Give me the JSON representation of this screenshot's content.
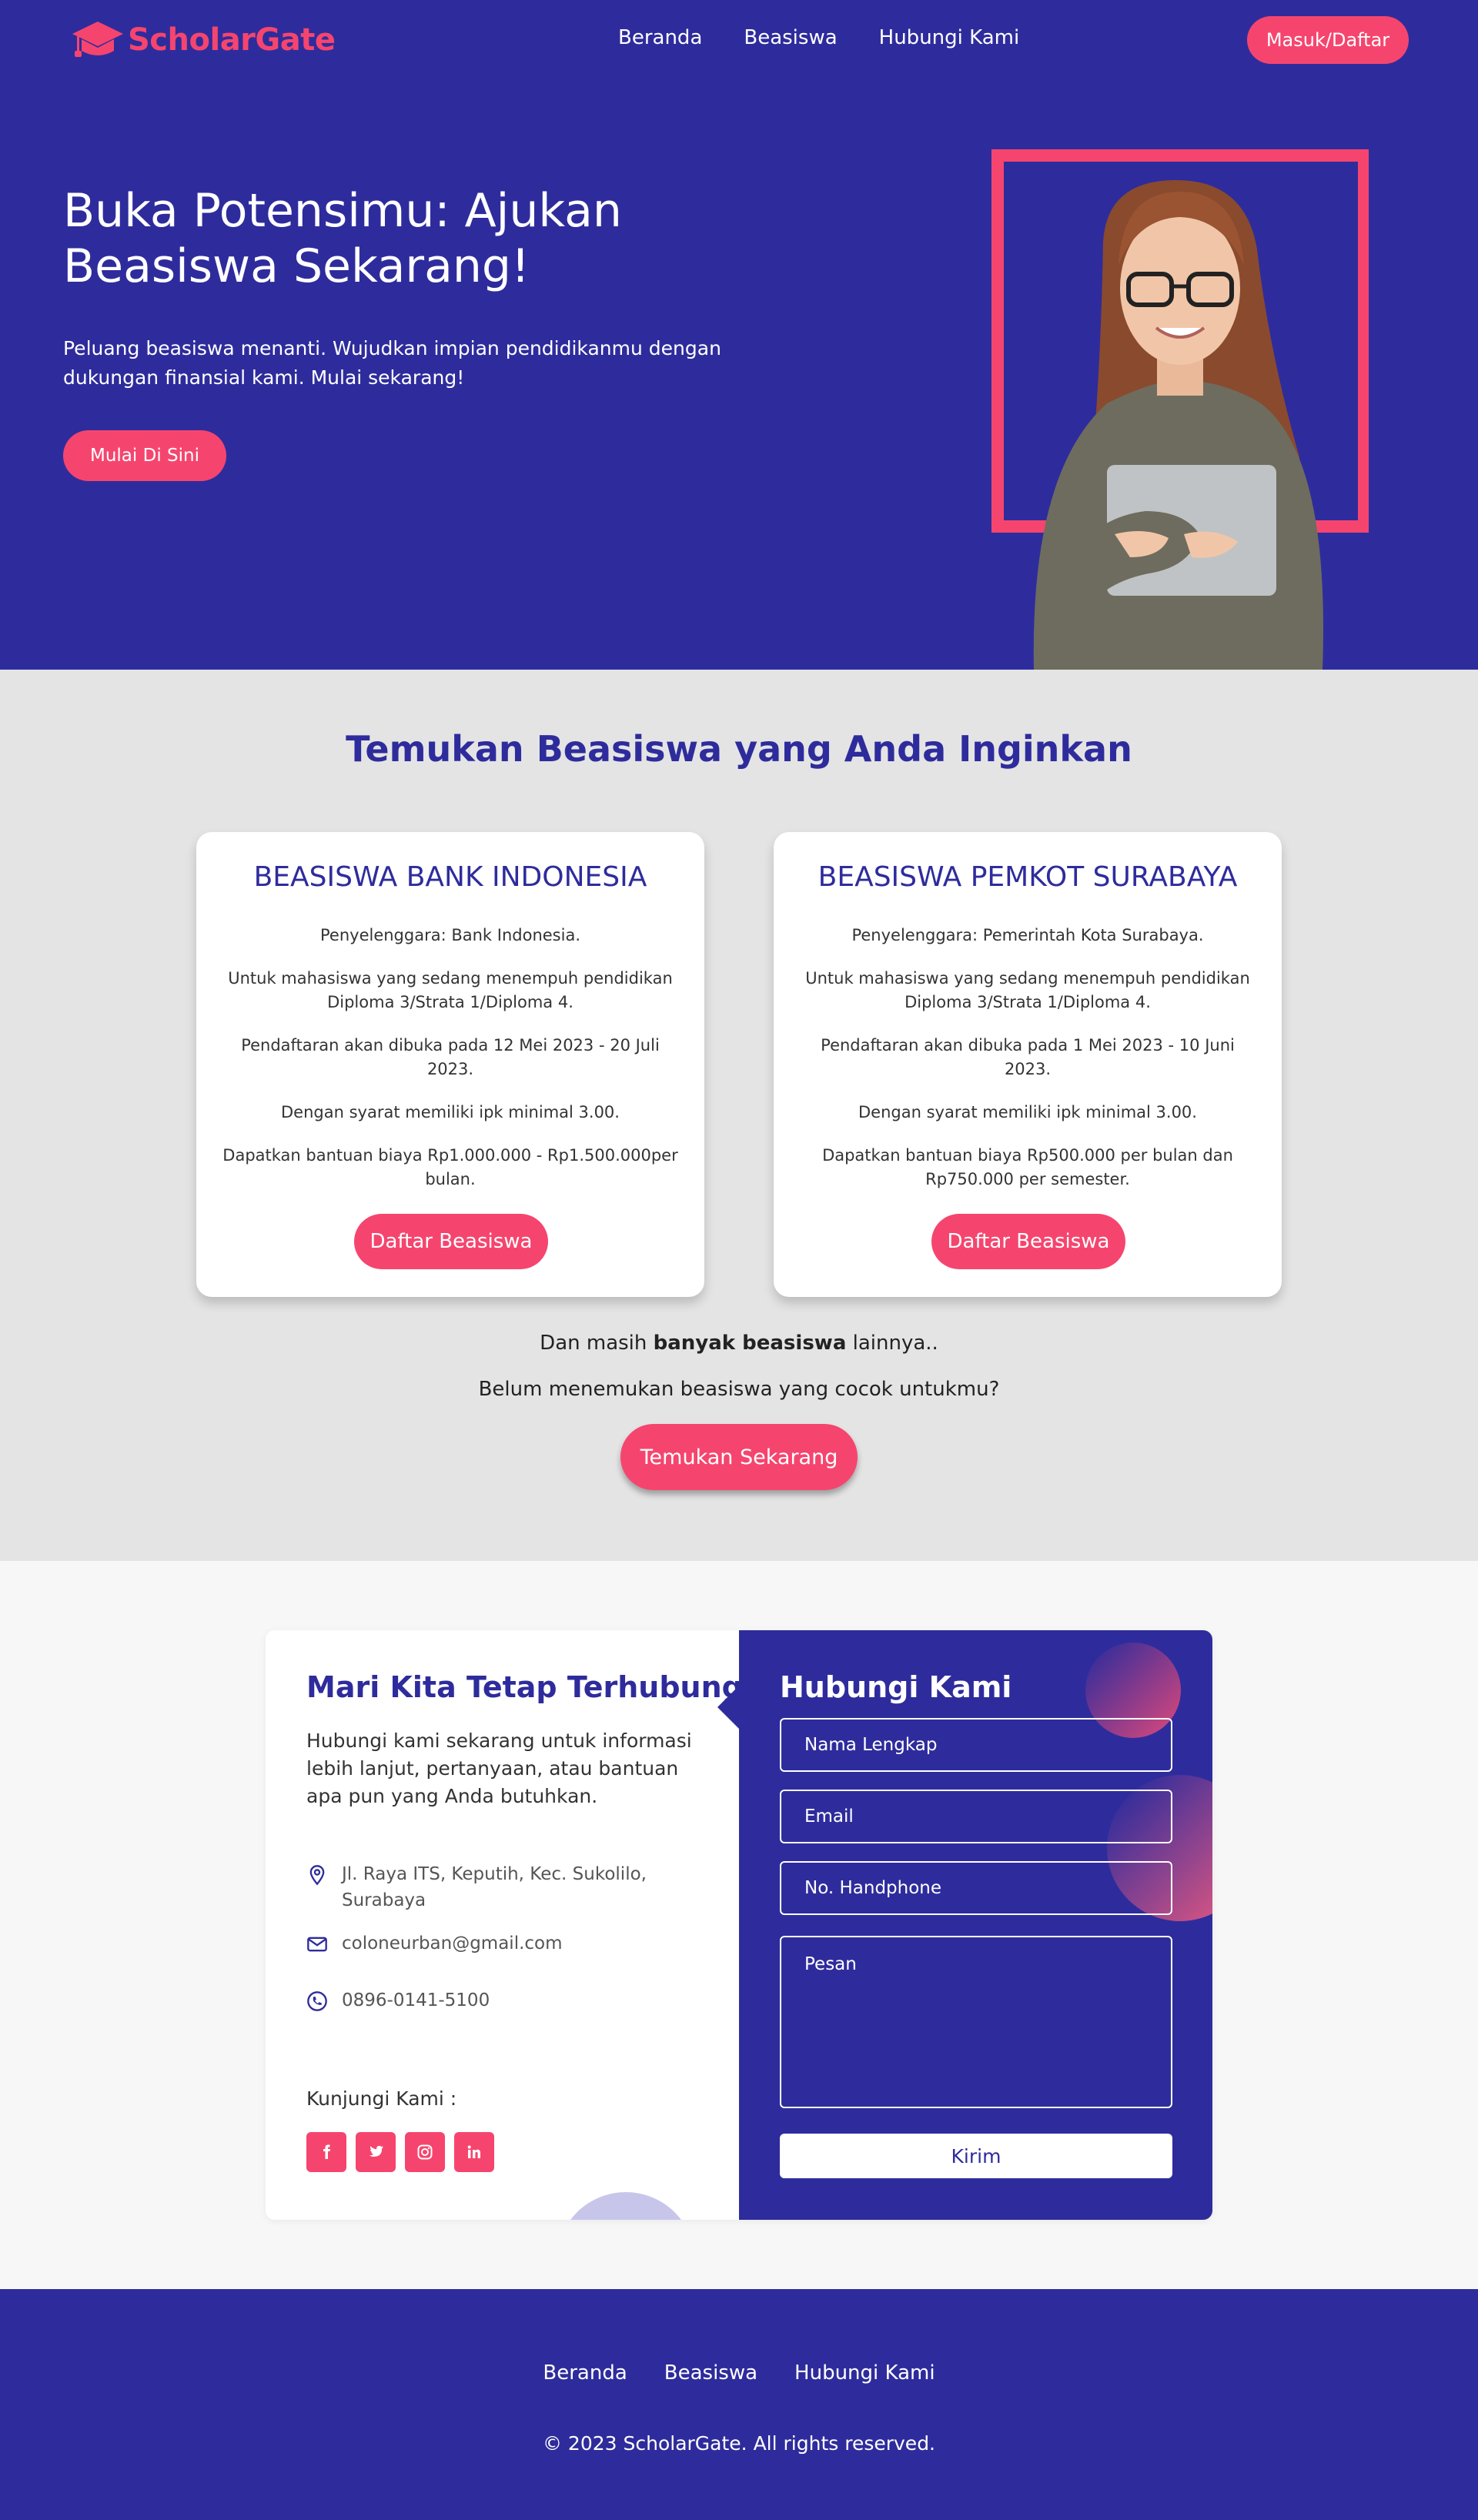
{
  "brand": {
    "name": "ScholarGate"
  },
  "nav": {
    "links": [
      "Beranda",
      "Beasiswa",
      "Hubungi Kami"
    ],
    "login_label": "Masuk/Daftar"
  },
  "hero": {
    "title": "Buka Potensimu: Ajukan Beasiswa Sekarang!",
    "subtitle": "Peluang beasiswa menanti. Wujudkan impian pendidikanmu dengan dukungan finansial kami. Mulai sekarang!",
    "cta_label": "Mulai Di Sini"
  },
  "scholarships": {
    "title": "Temukan Beasiswa yang Anda Inginkan",
    "cards": [
      {
        "title": "BEASISWA BANK INDONESIA",
        "lines": [
          "Penyelenggara: Bank Indonesia.",
          "Untuk mahasiswa yang sedang menempuh pendidikan Diploma 3/Strata 1/Diploma 4.",
          "Pendaftaran akan dibuka pada 12 Mei 2023 - 20 Juli 2023.",
          "Dengan syarat memiliki ipk minimal 3.00.",
          "Dapatkan bantuan biaya Rp1.000.000 - Rp1.500.000per bulan."
        ],
        "button_label": "Daftar Beasiswa"
      },
      {
        "title": "BEASISWA PEMKOT SURABAYA",
        "lines": [
          "Penyelenggara: Pemerintah Kota Surabaya.",
          "Untuk mahasiswa yang sedang menempuh pendidikan Diploma 3/Strata 1/Diploma 4.",
          "Pendaftaran akan dibuka pada 1 Mei 2023 - 10 Juni 2023.",
          "Dengan syarat memiliki ipk minimal 3.00.",
          "Dapatkan bantuan biaya Rp500.000 per bulan dan Rp750.000 per semester."
        ],
        "button_label": "Daftar Beasiswa"
      }
    ],
    "more_prefix": "Dan masih ",
    "more_bold": "banyak beasiswa",
    "more_suffix": " lainnya..",
    "find_text": "Belum menemukan beasiswa yang cocok untukmu?",
    "find_button": "Temukan Sekarang"
  },
  "contact": {
    "title": "Mari Kita Tetap Terhubung",
    "description": "Hubungi kami sekarang untuk informasi lebih lanjut, pertanyaan, atau bantuan apa pun yang Anda butuhkan.",
    "address": "Jl. Raya ITS, Keputih, Kec. Sukolilo, Surabaya",
    "email": "coloneurban@gmail.com",
    "phone": "0896-0141-5100",
    "visit_label": "Kunjungi Kami :",
    "socials": [
      "facebook-icon",
      "twitter-icon",
      "instagram-icon",
      "linkedin-icon"
    ],
    "form": {
      "title": "Hubungi Kami",
      "name_placeholder": "Nama Lengkap",
      "email_placeholder": "Email",
      "phone_placeholder": "No. Handphone",
      "message_placeholder": "Pesan",
      "submit_label": "Kirim"
    }
  },
  "footer": {
    "links": [
      "Beranda",
      "Beasiswa",
      "Hubungi Kami"
    ],
    "copyright": "© 2023 ScholarGate. All rights reserved."
  },
  "colors": {
    "primary": "#2e2c9c",
    "accent": "#f5456e",
    "section_bg": "#e4e4e4"
  }
}
